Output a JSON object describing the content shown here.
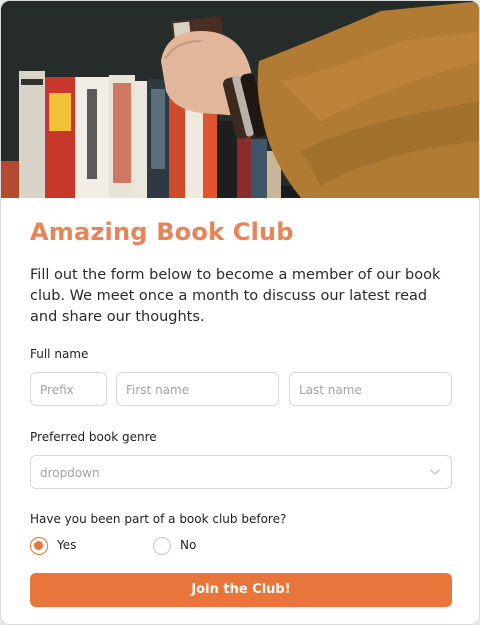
{
  "header": {
    "title": "Amazing Book Club",
    "intro": "Fill out the form below to become a member of our book club. We meet once a month to discuss our latest read and share our thoughts."
  },
  "form": {
    "full_name": {
      "label": "Full name",
      "prefix_placeholder": "Prefix",
      "first_placeholder": "First name",
      "last_placeholder": "Last name"
    },
    "genre": {
      "label": "Preferred book genre",
      "placeholder": "dropdown"
    },
    "prior_club": {
      "label": "Have you been part of a book club before?",
      "options": [
        {
          "label": "Yes",
          "checked": true
        },
        {
          "label": "No",
          "checked": false
        }
      ]
    },
    "submit_label": "Join the Club!"
  },
  "colors": {
    "accent": "#e8763a",
    "title": "#e8845a"
  }
}
